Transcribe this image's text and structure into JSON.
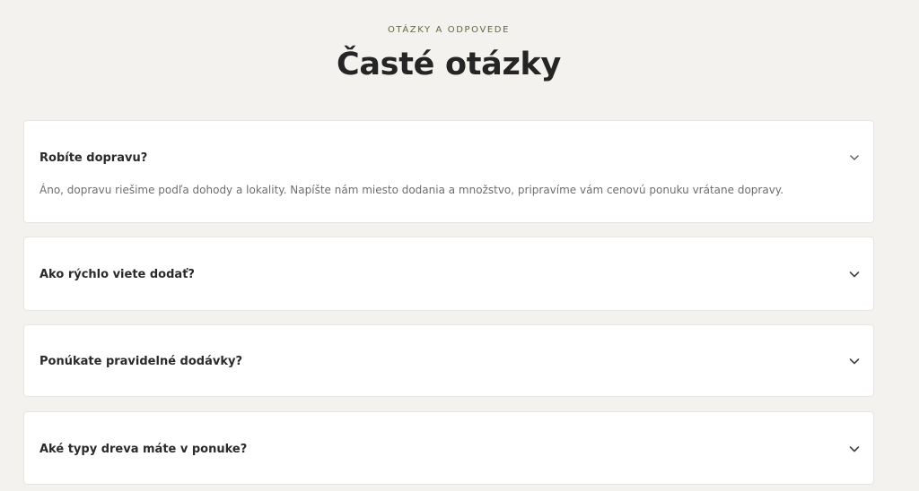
{
  "header": {
    "eyebrow": "OTÁZKY A ODPOVEDE",
    "title": "Časté otázky"
  },
  "faq": [
    {
      "question": "Robíte dopravu?",
      "answer": "Áno, dopravu riešime podľa dohody a lokality. Napíšte nám miesto dodania a množstvo, pripravíme vám cenovú ponuku vrátane dopravy.",
      "expanded": true,
      "icon": "chevron-down-icon"
    },
    {
      "question": "Ako rýchlo viete dodať?",
      "answer": "",
      "expanded": false,
      "icon": "chevron-down-icon"
    },
    {
      "question": "Ponúkate pravidelné dodávky?",
      "answer": "",
      "expanded": false,
      "icon": "chevron-down-icon"
    },
    {
      "question": "Aké typy dreva máte v ponuke?",
      "answer": "",
      "expanded": false,
      "icon": "chevron-down-icon"
    }
  ],
  "colors": {
    "background": "#f3f2ee",
    "card": "#ffffff",
    "eyebrow": "#5f6b3a",
    "heading": "#252525",
    "answer_text": "#6e6e6e"
  }
}
